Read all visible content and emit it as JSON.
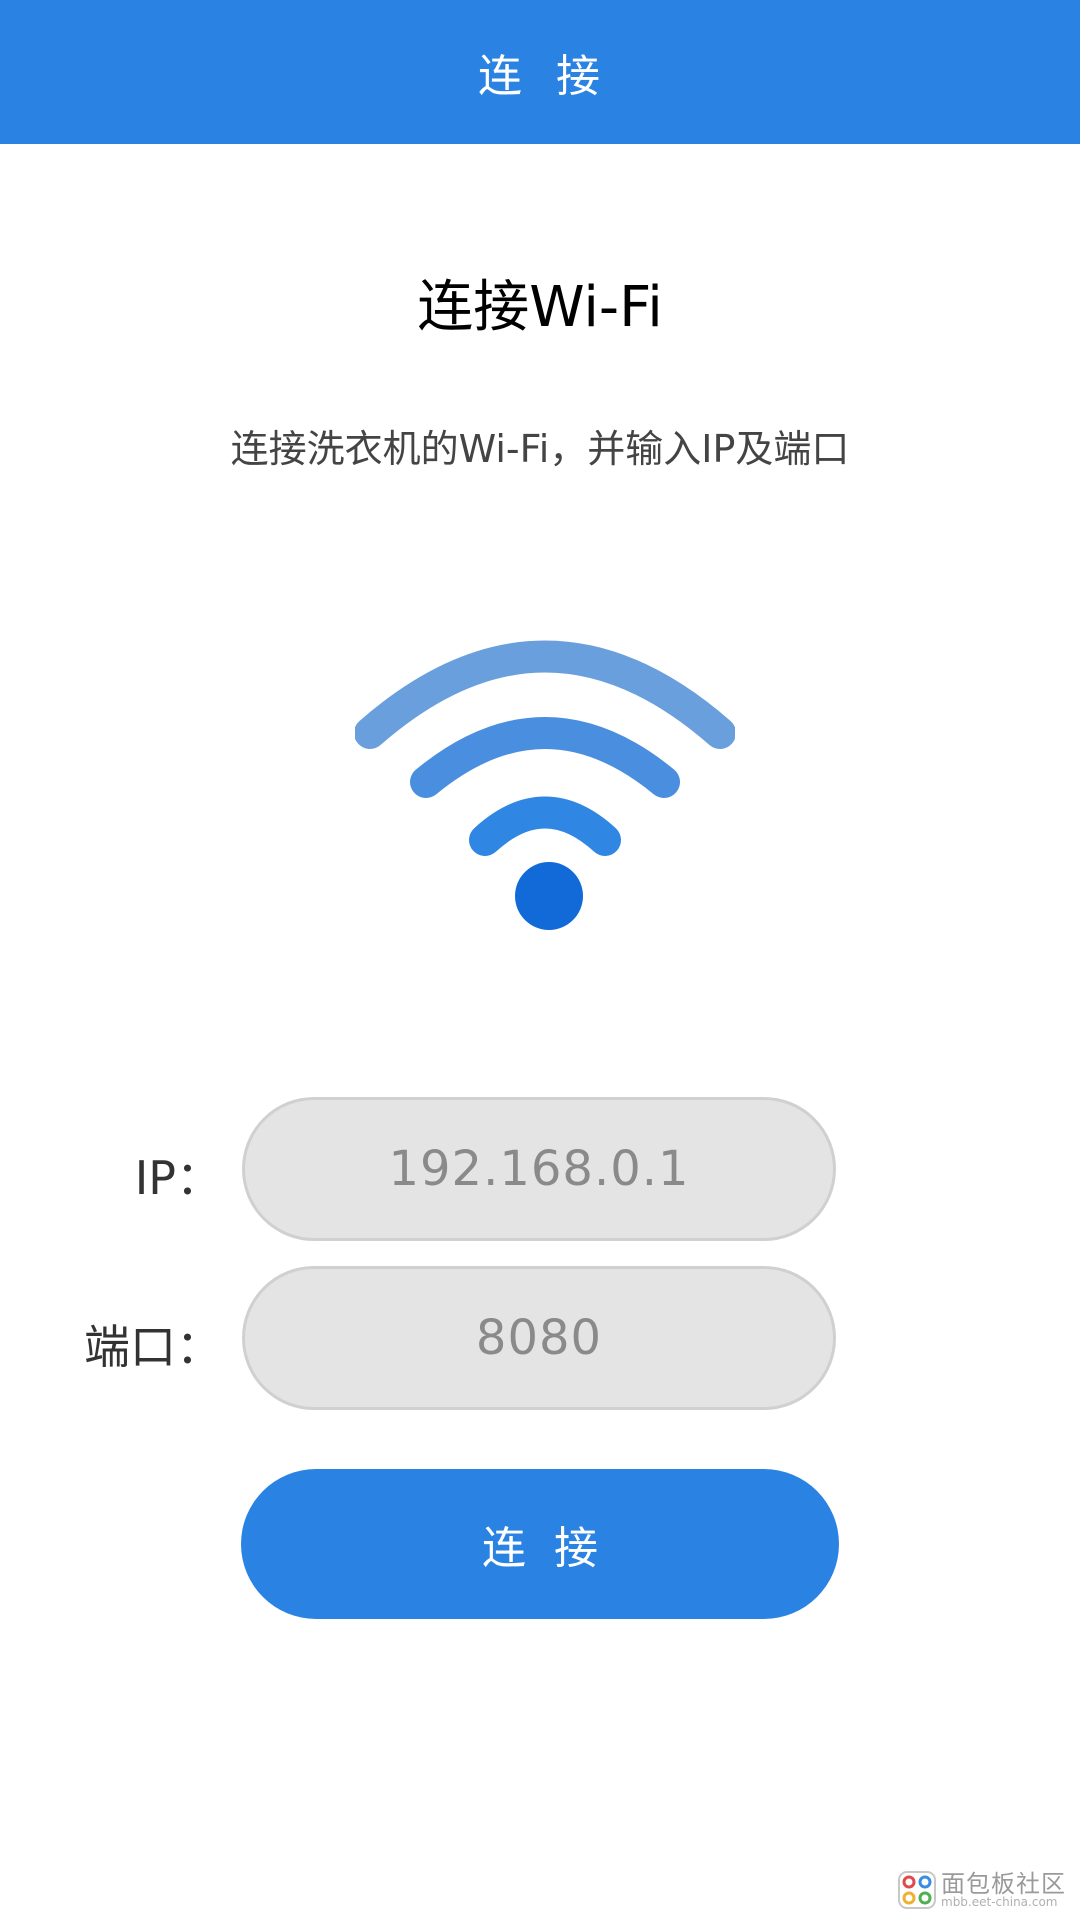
{
  "app_bar": {
    "title": "连  接"
  },
  "main": {
    "heading": "连接Wi-Fi",
    "subtitle": "连接洗衣机的Wi-Fi，并输入IP及端口",
    "wifi_icon": "wifi-icon"
  },
  "form": {
    "ip_label": "IP：",
    "ip_value": "192.168.0.1",
    "port_label": "端口：",
    "port_value": "8080",
    "connect_label": "连  接"
  },
  "watermark": {
    "name": "面包板社区",
    "url": "mbb.eet-china.com"
  },
  "colors": {
    "primary": "#2a83e2",
    "wifi_arc_outer": "#6a9fde",
    "wifi_arc_middle": "#4a8edf",
    "wifi_arc_inner": "#2f86e3",
    "wifi_dot": "#126ad9",
    "field_background": "#e4e4e4"
  }
}
